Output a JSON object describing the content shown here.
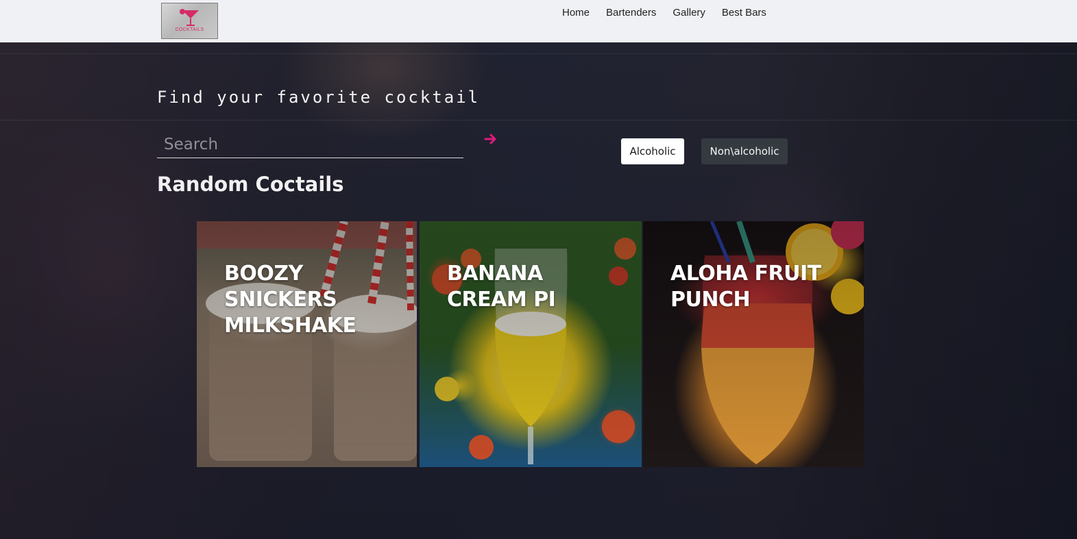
{
  "header": {
    "logo_text": "COCKTAILS",
    "nav": [
      {
        "label": "Home"
      },
      {
        "label": "Bartenders"
      },
      {
        "label": "Gallery"
      },
      {
        "label": "Best Bars"
      }
    ]
  },
  "hero": {
    "title": "Find your favorite cocktail",
    "search": {
      "placeholder": "Search",
      "value": "",
      "submit_icon": "arrow-right-icon"
    },
    "filters": {
      "alcoholic": "Alcoholic",
      "non_alcoholic": "Non\\alcoholic"
    },
    "section_title": "Random Coctails"
  },
  "cards": [
    {
      "title": "Boozy Snickers Milkshake"
    },
    {
      "title": "Banana Cream Pi"
    },
    {
      "title": "Aloha Fruit Punch"
    }
  ],
  "colors": {
    "accent": "#e0197a",
    "nav_bg": "#f0f1f5",
    "button_dark": "#343a40"
  }
}
